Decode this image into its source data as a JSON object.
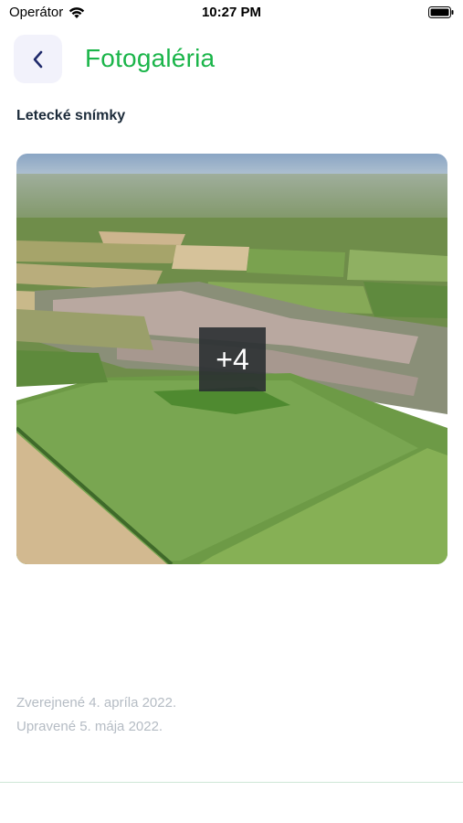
{
  "status_bar": {
    "carrier": "Operátor",
    "time": "10:27 PM"
  },
  "header": {
    "title": "Fotogaléria",
    "back_icon": "chevron-left-icon",
    "accent_color": "#1bb54a"
  },
  "section": {
    "title": "Letecké snímky"
  },
  "gallery": {
    "more_count_label": "+4"
  },
  "meta": {
    "published": "Zverejnené 4. apríla 2022.",
    "updated": "Upravené 5. mája 2022."
  }
}
